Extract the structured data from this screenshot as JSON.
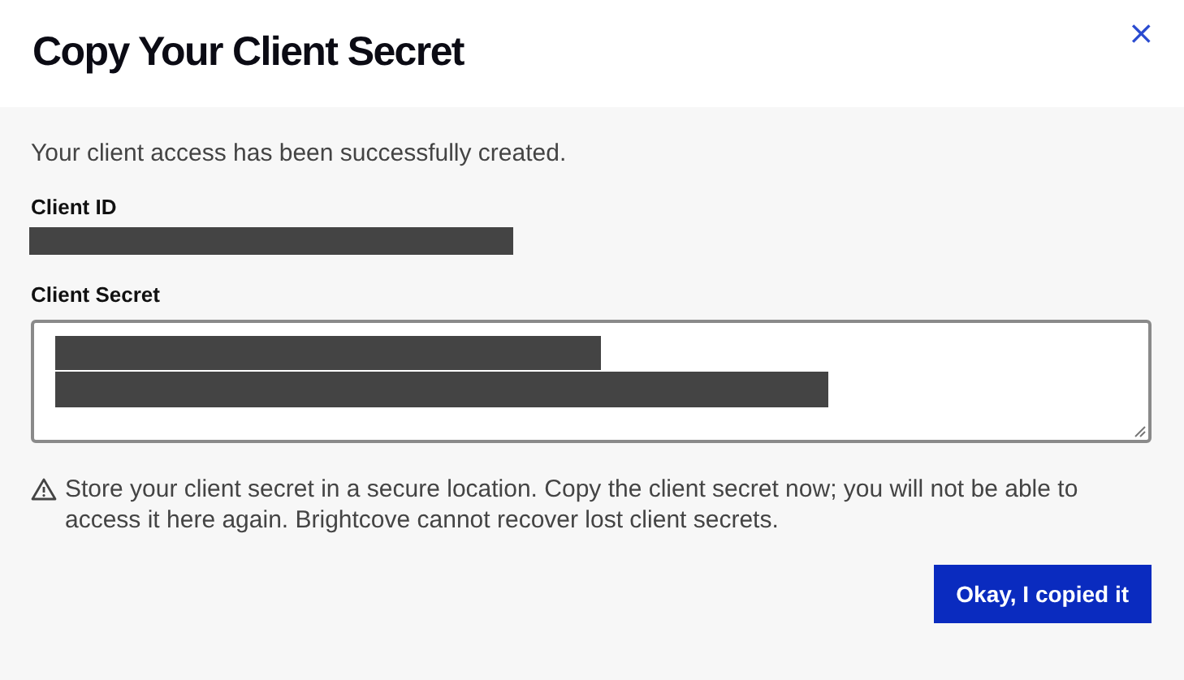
{
  "dialog": {
    "title": "Copy Your Client Secret",
    "close": "×",
    "message": "Your client access has been successfully created.",
    "fields": [
      {
        "label": "Client ID",
        "kind": "value"
      },
      {
        "label": "Client Secret",
        "kind": "textarea"
      }
    ],
    "warning": "Store your client secret in a secure location. Copy the client secret now; you will not be able to access it here again. Brightcove cannot recover lost client secrets.",
    "button": "Okay, I copied it"
  }
}
